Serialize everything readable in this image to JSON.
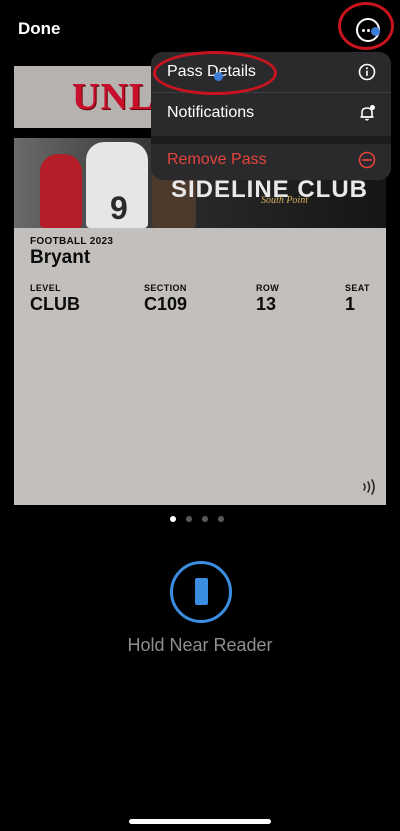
{
  "nav": {
    "done_label": "Done"
  },
  "menu": {
    "items": [
      {
        "label": "Pass Details",
        "icon": "info-circle-icon",
        "color": "#ffffff"
      },
      {
        "label": "Notifications",
        "icon": "bell-badge-icon",
        "color": "#ffffff"
      },
      {
        "label": "Remove Pass",
        "icon": "minus-circle-icon",
        "color": "#e5433b"
      }
    ]
  },
  "pass": {
    "logo_text": "UNLV",
    "banner_text": "SIDELINE CLUB",
    "banner_sub": "South Point",
    "jersey_number": "9",
    "event_label": "FOOTBALL 2023",
    "holder_name": "Bryant",
    "fields": [
      {
        "label": "LEVEL",
        "value": "CLUB"
      },
      {
        "label": "SECTION",
        "value": "C109"
      },
      {
        "label": "ROW",
        "value": "13"
      },
      {
        "label": "SEAT",
        "value": "1"
      }
    ]
  },
  "pager": {
    "count": 4,
    "active": 0
  },
  "reader": {
    "text": "Hold Near Reader"
  },
  "colors": {
    "accent": "#3a8de0",
    "destructive": "#e5433b",
    "highlight": "#c8141e",
    "brand": "#c8102e"
  }
}
